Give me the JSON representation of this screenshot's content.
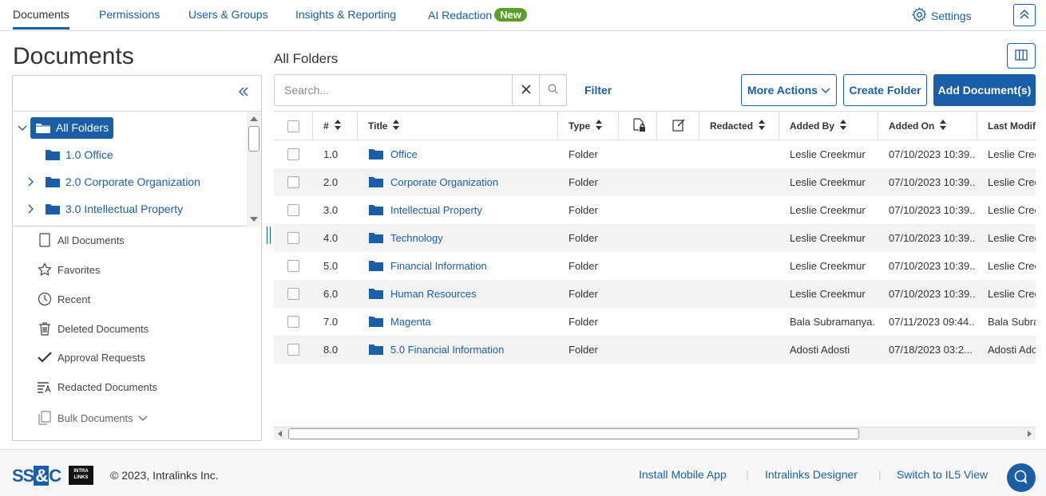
{
  "nav": {
    "tabs": [
      {
        "label": "Documents",
        "active": true
      },
      {
        "label": "Permissions"
      },
      {
        "label": "Users & Groups"
      },
      {
        "label": "Insights & Reporting"
      },
      {
        "label": "AI Redaction",
        "badge": "New"
      }
    ],
    "settings_label": "Settings"
  },
  "page_title": "Documents",
  "tree": {
    "items": [
      {
        "label": "All Folders",
        "selected": true,
        "expanded": true
      },
      {
        "label": "1.0 Office"
      },
      {
        "label": "2.0 Corporate Organization"
      },
      {
        "label": "3.0 Intellectual Property"
      }
    ]
  },
  "quick_links": [
    {
      "label": "All Documents",
      "icon": "document-icon"
    },
    {
      "label": "Favorites",
      "icon": "star-icon"
    },
    {
      "label": "Recent",
      "icon": "clock-icon"
    },
    {
      "label": "Deleted Documents",
      "icon": "trash-icon"
    },
    {
      "label": "Approval Requests",
      "icon": "checkmark-icon"
    },
    {
      "label": "Redacted Documents",
      "icon": "redact-icon"
    },
    {
      "label": "Bulk Documents",
      "icon": "bulk-documents-icon"
    }
  ],
  "main": {
    "breadcrumb": "All Folders",
    "search_placeholder": "Search...",
    "filter_label": "Filter",
    "more_actions_label": "More Actions",
    "create_folder_label": "Create Folder",
    "add_documents_label": "Add Document(s)"
  },
  "grid": {
    "columns": [
      "#",
      "Title",
      "Type",
      "",
      "",
      "Redacted",
      "Added By",
      "Added On",
      "Last Modif"
    ],
    "rows": [
      {
        "num": "1.0",
        "title": "Office",
        "type": "Folder",
        "added_by": "Leslie Creekmur",
        "added_on": "07/10/2023 10:39...",
        "last_mod": "Leslie Cree"
      },
      {
        "num": "2.0",
        "title": "Corporate Organization",
        "type": "Folder",
        "added_by": "Leslie Creekmur",
        "added_on": "07/10/2023 10:39...",
        "last_mod": "Leslie Cree"
      },
      {
        "num": "3.0",
        "title": "Intellectual Property",
        "type": "Folder",
        "added_by": "Leslie Creekmur",
        "added_on": "07/10/2023 10:39...",
        "last_mod": "Leslie Cree"
      },
      {
        "num": "4.0",
        "title": "Technology",
        "type": "Folder",
        "added_by": "Leslie Creekmur",
        "added_on": "07/10/2023 10:39...",
        "last_mod": "Leslie Cree"
      },
      {
        "num": "5.0",
        "title": "Financial Information",
        "type": "Folder",
        "added_by": "Leslie Creekmur",
        "added_on": "07/10/2023 10:39...",
        "last_mod": "Leslie Cree"
      },
      {
        "num": "6.0",
        "title": "Human Resources",
        "type": "Folder",
        "added_by": "Leslie Creekmur",
        "added_on": "07/10/2023 10:39...",
        "last_mod": "Leslie Cree"
      },
      {
        "num": "7.0",
        "title": "Magenta",
        "type": "Folder",
        "added_by": "Bala Subramanya...",
        "added_on": "07/11/2023 09:44...",
        "last_mod": "Bala Subra"
      },
      {
        "num": "8.0",
        "title": "5.0 Financial Information",
        "type": "Folder",
        "added_by": "Adosti Adosti",
        "added_on": "07/18/2023 03:2...",
        "last_mod": "Adosti Ado"
      }
    ]
  },
  "footer": {
    "logo_text": "SS&C",
    "logo_il": "INTRA LINKS",
    "copyright": "© 2023, Intralinks Inc.",
    "links": [
      "Install Mobile App",
      "Intralinks Designer",
      "Switch to IL5 View"
    ]
  },
  "colors": {
    "accent": "#1a5fa6",
    "badge": "#5a9e2c"
  }
}
